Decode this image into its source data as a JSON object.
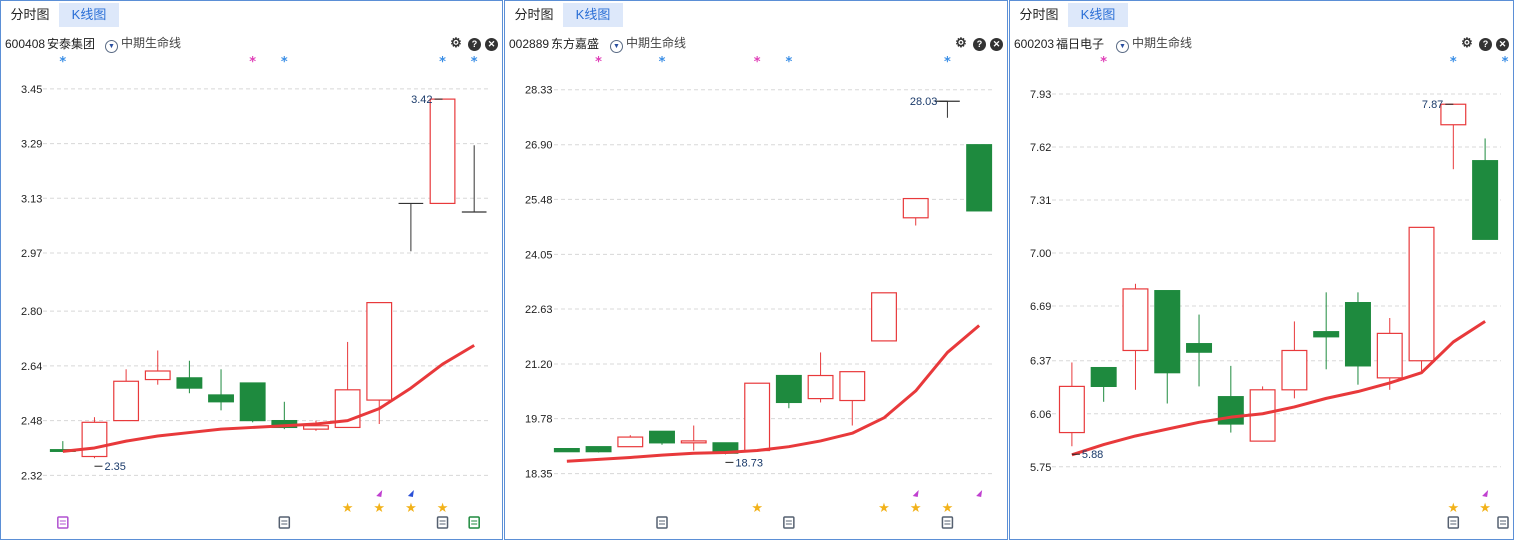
{
  "tabs": [
    "分时图",
    "K线图"
  ],
  "indicator_label": "中期生命线",
  "colors": {
    "up": "#e8393b",
    "down": "#1e8a3e",
    "ma": "#e8393b",
    "tab_active_bg": "#dde8fa",
    "border": "#5b8fd6"
  },
  "icons": [
    "chevron-down-icon",
    "settings-icon",
    "help-icon",
    "close-icon",
    "star-icon",
    "flag-icon",
    "calendar-icon"
  ],
  "panels": [
    {
      "code": "600408",
      "name": "安泰集团",
      "chart_data": {
        "type": "candlestick",
        "y_ticks": [
          "3.45",
          "3.29",
          "3.13",
          "2.97",
          "2.80",
          "2.64",
          "2.48",
          "2.32"
        ],
        "ylim": [
          2.28,
          3.47
        ],
        "candles": [
          {
            "o": 2.395,
            "h": 2.42,
            "l": 2.39,
            "c": 2.39,
            "down": true
          },
          {
            "o": 2.375,
            "h": 2.49,
            "l": 2.37,
            "c": 2.475,
            "down": false
          },
          {
            "o": 2.48,
            "h": 2.63,
            "l": 2.48,
            "c": 2.595,
            "down": false
          },
          {
            "o": 2.6,
            "h": 2.685,
            "l": 2.585,
            "c": 2.625,
            "down": false
          },
          {
            "o": 2.605,
            "h": 2.655,
            "l": 2.56,
            "c": 2.575,
            "down": true
          },
          {
            "o": 2.555,
            "h": 2.63,
            "l": 2.51,
            "c": 2.535,
            "down": true
          },
          {
            "o": 2.59,
            "h": 2.59,
            "l": 2.475,
            "c": 2.48,
            "down": true
          },
          {
            "o": 2.48,
            "h": 2.535,
            "l": 2.455,
            "c": 2.46,
            "down": true
          },
          {
            "o": 2.455,
            "h": 2.48,
            "l": 2.45,
            "c": 2.465,
            "down": false
          },
          {
            "o": 2.46,
            "h": 2.71,
            "l": 2.46,
            "c": 2.57,
            "down": false
          },
          {
            "o": 2.54,
            "h": 2.825,
            "l": 2.47,
            "c": 2.825,
            "down": false
          },
          {
            "o": 3.115,
            "h": 3.115,
            "l": 2.975,
            "c": 3.115,
            "down": true
          },
          {
            "o": 3.115,
            "h": 3.42,
            "l": 3.115,
            "c": 3.42,
            "down": false
          },
          {
            "o": 3.09,
            "h": 3.285,
            "l": 3.09,
            "c": 3.09,
            "down": true
          }
        ],
        "ma": [
          2.39,
          2.4,
          2.42,
          2.435,
          2.445,
          2.455,
          2.46,
          2.465,
          2.47,
          2.48,
          2.515,
          2.575,
          2.645,
          2.7
        ],
        "max_label": "3.42",
        "min_label": "2.35",
        "signals_top": [
          {
            "i": 0,
            "c": "#3a8ee6"
          },
          {
            "i": 6,
            "c": "#e040b8"
          },
          {
            "i": 7,
            "c": "#3a8ee6"
          },
          {
            "i": 12,
            "c": "#3a8ee6"
          },
          {
            "i": 13,
            "c": "#3a8ee6"
          }
        ],
        "flags": [
          {
            "i": 10,
            "c": "#c040d0"
          },
          {
            "i": 11,
            "c": "#2a4fd6"
          }
        ],
        "stars": [
          9,
          10,
          11,
          12
        ],
        "badges": [
          {
            "i": 0,
            "c": "#b050d0"
          },
          {
            "i": 7,
            "c": "#556070"
          },
          {
            "i": 12,
            "c": "#556070"
          },
          {
            "i": 13,
            "c": "#1e8a3e"
          }
        ]
      }
    },
    {
      "code": "002889",
      "name": "东方嘉盛",
      "chart_data": {
        "type": "candlestick",
        "y_ticks": [
          "28.33",
          "26.90",
          "25.48",
          "24.05",
          "22.63",
          "21.20",
          "19.78",
          "18.35"
        ],
        "ylim": [
          17.95,
          28.53
        ],
        "candles": [
          {
            "o": 19.0,
            "h": 19.0,
            "l": 18.95,
            "c": 18.92,
            "down": true
          },
          {
            "o": 19.05,
            "h": 19.05,
            "l": 18.9,
            "c": 18.92,
            "down": true
          },
          {
            "o": 19.05,
            "h": 19.35,
            "l": 19.05,
            "c": 19.3,
            "down": false
          },
          {
            "o": 19.45,
            "h": 19.45,
            "l": 19.1,
            "c": 19.15,
            "down": true
          },
          {
            "o": 19.15,
            "h": 19.6,
            "l": 18.95,
            "c": 19.2,
            "down": false
          },
          {
            "o": 19.15,
            "h": 19.15,
            "l": 18.85,
            "c": 18.88,
            "down": true
          },
          {
            "o": 18.95,
            "h": 20.7,
            "l": 18.95,
            "c": 20.7,
            "down": false
          },
          {
            "o": 20.9,
            "h": 20.9,
            "l": 20.05,
            "c": 20.2,
            "down": true
          },
          {
            "o": 20.3,
            "h": 21.5,
            "l": 20.2,
            "c": 20.9,
            "down": false
          },
          {
            "o": 20.25,
            "h": 21.0,
            "l": 19.6,
            "c": 21.0,
            "down": false
          },
          {
            "o": 21.8,
            "h": 23.05,
            "l": 21.8,
            "c": 23.05,
            "down": false
          },
          {
            "o": 25.0,
            "h": 25.5,
            "l": 24.8,
            "c": 25.5,
            "down": false
          },
          {
            "o": 28.03,
            "h": 28.03,
            "l": 27.6,
            "c": 28.03,
            "down": true
          },
          {
            "o": 26.9,
            "h": 26.9,
            "l": 25.18,
            "c": 25.18,
            "down": true
          }
        ],
        "ma": [
          18.67,
          18.72,
          18.77,
          18.83,
          18.88,
          18.9,
          18.95,
          19.05,
          19.2,
          19.4,
          19.8,
          20.5,
          21.5,
          22.2
        ],
        "max_label": "28.03",
        "min_label": "18.73",
        "signals_top": [
          {
            "i": 1,
            "c": "#e040b8"
          },
          {
            "i": 3,
            "c": "#3a8ee6"
          },
          {
            "i": 6,
            "c": "#e040b8"
          },
          {
            "i": 7,
            "c": "#3a8ee6"
          },
          {
            "i": 12,
            "c": "#3a8ee6"
          }
        ],
        "flags": [
          {
            "i": 11,
            "c": "#c040d0"
          },
          {
            "i": 13,
            "c": "#c040d0"
          }
        ],
        "stars": [
          6,
          10,
          11,
          12
        ],
        "badges": [
          {
            "i": 3,
            "c": "#556070"
          },
          {
            "i": 7,
            "c": "#556070"
          },
          {
            "i": 12,
            "c": "#556070"
          }
        ]
      }
    },
    {
      "code": "600203",
      "name": "福日电子",
      "chart_data": {
        "type": "candlestick",
        "y_ticks": [
          "7.93",
          "7.62",
          "7.31",
          "7.00",
          "6.69",
          "6.37",
          "6.06",
          "5.75"
        ],
        "ylim": [
          5.62,
          8.0
        ],
        "candles": [
          {
            "o": 5.95,
            "h": 6.36,
            "l": 5.87,
            "c": 6.22,
            "down": false
          },
          {
            "o": 6.33,
            "h": 6.33,
            "l": 6.13,
            "c": 6.22,
            "down": true
          },
          {
            "o": 6.43,
            "h": 6.82,
            "l": 6.2,
            "c": 6.79,
            "down": false
          },
          {
            "o": 6.78,
            "h": 6.78,
            "l": 6.12,
            "c": 6.3,
            "down": true
          },
          {
            "o": 6.47,
            "h": 6.64,
            "l": 6.22,
            "c": 6.42,
            "down": true
          },
          {
            "o": 6.16,
            "h": 6.34,
            "l": 5.95,
            "c": 6.0,
            "down": true
          },
          {
            "o": 5.9,
            "h": 6.22,
            "l": 5.9,
            "c": 6.2,
            "down": false
          },
          {
            "o": 6.2,
            "h": 6.6,
            "l": 6.15,
            "c": 6.43,
            "down": false
          },
          {
            "o": 6.54,
            "h": 6.77,
            "l": 6.32,
            "c": 6.51,
            "down": true
          },
          {
            "o": 6.71,
            "h": 6.77,
            "l": 6.23,
            "c": 6.34,
            "down": true
          },
          {
            "o": 6.27,
            "h": 6.62,
            "l": 6.2,
            "c": 6.53,
            "down": false
          },
          {
            "o": 6.37,
            "h": 7.15,
            "l": 6.3,
            "c": 7.15,
            "down": false
          },
          {
            "o": 7.75,
            "h": 7.87,
            "l": 7.49,
            "c": 7.87,
            "down": false
          },
          {
            "o": 7.54,
            "h": 7.67,
            "l": 7.08,
            "c": 7.08,
            "down": true
          }
        ],
        "ma": [
          5.82,
          5.88,
          5.93,
          5.97,
          6.01,
          6.04,
          6.06,
          6.1,
          6.15,
          6.19,
          6.24,
          6.3,
          6.48,
          6.6
        ],
        "max_label": "7.87",
        "min_label": "5.88",
        "signals_top": [
          {
            "i": 1,
            "c": "#e040b8"
          },
          {
            "i": 12,
            "c": "#3a8ee6"
          },
          {
            "i": 14,
            "c": "#3a8ee6"
          }
        ],
        "flags": [
          {
            "i": 13,
            "c": "#c040d0"
          }
        ],
        "stars": [
          12,
          13
        ],
        "badges": [
          {
            "i": 12,
            "c": "#556070"
          },
          {
            "i": 14,
            "c": "#556070"
          }
        ]
      }
    }
  ]
}
